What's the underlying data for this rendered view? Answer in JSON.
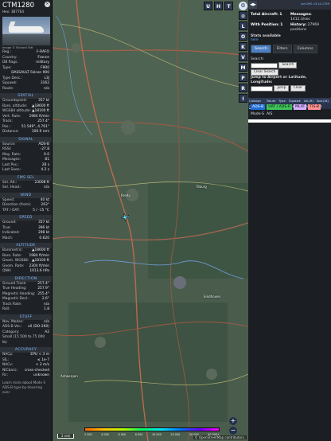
{
  "left_panel": {
    "callsign": "CTM1280",
    "hex_line": "Hex: 3B77E4",
    "photo_caption": "Image © Richard Toft",
    "info_rows": [
      {
        "k": "Reg.:",
        "v": "F-RAFO"
      },
      {
        "k": "Country:",
        "v": "France"
      },
      {
        "k": "DB flags:",
        "v": "military"
      },
      {
        "k": "Type:",
        "v": "F900"
      },
      {
        "k": "",
        "v": "DASSAULT Falcon 900"
      },
      {
        "k": "Type Desc.:",
        "v": "L3J"
      },
      {
        "k": "Squawk:",
        "v": "3162"
      },
      {
        "k": "Route:",
        "v": "n/a"
      }
    ],
    "sections": [
      {
        "title": "SPATIAL",
        "rows": [
          {
            "k": "Groundspeed:",
            "v": "357 kt"
          },
          {
            "k": "Baro. altitude:",
            "v": "▲18600 ft"
          },
          {
            "k": "WGS84 altitude:",
            "v": "▲18100 ft"
          },
          {
            "k": "Vert. Rate:",
            "v": "1984 ft/min"
          },
          {
            "k": "Track:",
            "v": "257.4°"
          },
          {
            "k": "Pos.:",
            "v": "51.549°, 4.761°"
          },
          {
            "k": "Distance:",
            "v": "106.9 nmi"
          }
        ]
      },
      {
        "title": "SIGNAL",
        "rows": [
          {
            "k": "Source:",
            "v": "ADS-B"
          },
          {
            "k": "RSSI:",
            "v": "-27.8"
          },
          {
            "k": "Msg. Rate:",
            "v": "0.0"
          },
          {
            "k": "Messages:",
            "v": "81"
          },
          {
            "k": "Last Pos.:",
            "v": "28 s"
          },
          {
            "k": "Last Seen:",
            "v": "4.2 s"
          }
        ]
      },
      {
        "title": "FMS SEL",
        "rows": [
          {
            "k": "Sel. Alt.:",
            "v": "23008 ft"
          },
          {
            "k": "Sel. Head.:",
            "v": "n/a"
          }
        ]
      },
      {
        "title": "WIND",
        "rows": [
          {
            "k": "Speed:",
            "v": "40 kt"
          },
          {
            "k": "Direction (from):",
            "v": "263°"
          },
          {
            "k": "TAT / OAT:",
            "v": "5 / -15 °C"
          }
        ]
      },
      {
        "title": "SPEED",
        "rows": [
          {
            "k": "Ground:",
            "v": "357 kt"
          },
          {
            "k": "True:",
            "v": "396 kt"
          },
          {
            "k": "Indicated:",
            "v": "298 kt"
          },
          {
            "k": "Mach:",
            "v": "0.620"
          }
        ]
      },
      {
        "title": "ALTITUDE",
        "rows": [
          {
            "k": "Barometric:",
            "v": "▲18600 ft"
          },
          {
            "k": "Baro. Rate:",
            "v": "1984 ft/min"
          },
          {
            "k": "Geom. WGS84:",
            "v": "▲18100 ft"
          },
          {
            "k": "Geom. Rate:",
            "v": "2304 ft/min"
          },
          {
            "k": "QNH:",
            "v": "1013.6 hPa"
          }
        ]
      },
      {
        "title": "DIRECTION",
        "rows": [
          {
            "k": "Ground Track:",
            "v": "257.4°"
          },
          {
            "k": "True Heading:",
            "v": "257.9°"
          },
          {
            "k": "Magnetic Heading:",
            "v": "255.4°"
          },
          {
            "k": "Magnetic Decl.:",
            "v": "2.6°"
          },
          {
            "k": "Track Rate:",
            "v": "n/a"
          },
          {
            "k": "Roll:",
            "v": "1.8"
          }
        ]
      },
      {
        "title": "STUFF",
        "rows": [
          {
            "k": "Nav. Modes:",
            "v": "n/a"
          },
          {
            "k": "ADS-B Ver.:",
            "v": "v0 (DO-260)"
          },
          {
            "k": "Category:",
            "v": "A2"
          },
          {
            "k": "Small (15 500 to 75 000 lb)",
            "v": ""
          }
        ]
      },
      {
        "title": "ACCURACY",
        "rows": [
          {
            "k": "NACp:",
            "v": "EPU < 3 m"
          },
          {
            "k": "SIL:",
            "v": "≤ 1e-7"
          },
          {
            "k": "NACv:",
            "v": "< 3 m/s"
          },
          {
            "k": "NICbaro:",
            "v": "cross-checked"
          },
          {
            "k": "Rc:",
            "v": "unknown"
          }
        ]
      }
    ],
    "footer_note": "Learn more about Mode S ADS-B type by hovering over"
  },
  "map": {
    "top_buttons": [
      "U",
      "H",
      "T"
    ],
    "side_buttons": [
      "L",
      "O",
      "K",
      "V",
      "M",
      "P",
      "R",
      "I"
    ],
    "zoom_in": "+",
    "zoom_out": "−",
    "towns": [
      "Breda",
      "Antwerpen",
      "Tilburg",
      "Eindhoven"
    ],
    "colorbar_labels": [
      "2 000",
      "4 000",
      "6 000",
      "8 000",
      "10 000",
      "20 000",
      "30 000",
      "40 000+"
    ],
    "scale_label": "2 nmi",
    "attribution": "© OpenStreetMap contributors."
  },
  "right_panel": {
    "version": "tar1090 v3.14.1769",
    "total_aircraft_label": "Total Aircraft:",
    "total_aircraft": "1",
    "with_position_label": "With Position:",
    "with_position": "1",
    "messages_label": "Messages:",
    "messages": "1412.3/sec",
    "history_label": "History:",
    "history": "27969 positions",
    "stats_label": "Stats available",
    "stats_link": "here",
    "tabs": [
      "Search",
      "Filters",
      "Columns"
    ],
    "search_label": "Search:",
    "search_button": "Search",
    "clear_search": "Clear Search",
    "jump_label": "Jump to Airport or Latitude, Longitude:",
    "jump_button": "Jump",
    "clear_button": "Clear",
    "table_headers": [
      "Callsign",
      "Route",
      "Type",
      "Squawk",
      "Alt.(ft)",
      "Spd.(kt)"
    ],
    "table_rows": [
      [
        "CTM1280",
        "",
        "F900",
        "3162",
        "18600",
        "357"
      ]
    ],
    "source_filters": [
      {
        "label": "ADS-B",
        "color": "#1f6fd8"
      },
      {
        "label": "UAT / ADS-R",
        "color": "#3fc45a"
      },
      {
        "label": "MLAT",
        "color": "#d8b0ff"
      },
      {
        "label": "TIS-B",
        "color": "#ff9090"
      }
    ],
    "modes_label": "Mode-S",
    "ais_label": "AIS"
  }
}
